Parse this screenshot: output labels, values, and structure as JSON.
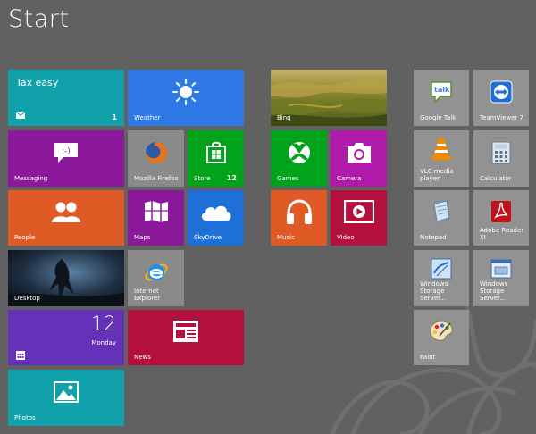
{
  "screen": {
    "title": "Start"
  },
  "tiles": {
    "tax_easy": {
      "title": "Tax easy",
      "badge": "1"
    },
    "weather": {
      "label": "Weather"
    },
    "bing": {
      "label": "Bing"
    },
    "google_talk": {
      "label": "Google Talk",
      "icon_text": "talk"
    },
    "teamviewer": {
      "label": "TeamViewer 7"
    },
    "messaging": {
      "label": "Messaging"
    },
    "firefox": {
      "label": "Mozilla Firefox"
    },
    "store": {
      "label": "Store",
      "badge": "12"
    },
    "games": {
      "label": "Games"
    },
    "camera": {
      "label": "Camera"
    },
    "vlc": {
      "label": "VLC media player"
    },
    "calculator": {
      "label": "Calculator"
    },
    "people": {
      "label": "People"
    },
    "maps": {
      "label": "Maps"
    },
    "skydrive": {
      "label": "SkyDrive"
    },
    "music": {
      "label": "Music"
    },
    "video": {
      "label": "Video"
    },
    "notepad": {
      "label": "Notepad"
    },
    "adobe_reader": {
      "label": "Adobe Reader XI"
    },
    "desktop": {
      "label": "Desktop"
    },
    "internet_explorer": {
      "label": "Internet Explorer"
    },
    "wss1": {
      "label": "Windows Storage Server..."
    },
    "wss2": {
      "label": "Windows Storage Server..."
    },
    "calendar": {
      "day": "12",
      "weekday": "Monday"
    },
    "news": {
      "label": "News"
    },
    "paint": {
      "label": "Paint"
    },
    "photos": {
      "label": "Photos"
    }
  },
  "colors": {
    "background": "#616161",
    "cyan": "#11a1ab",
    "blue": "#2f79e6",
    "purple": "#8c199b",
    "orange": "#e05a25",
    "green": "#00a31a",
    "red": "#b4103e",
    "violet": "#6431b8",
    "gray_tile": "#929292"
  }
}
